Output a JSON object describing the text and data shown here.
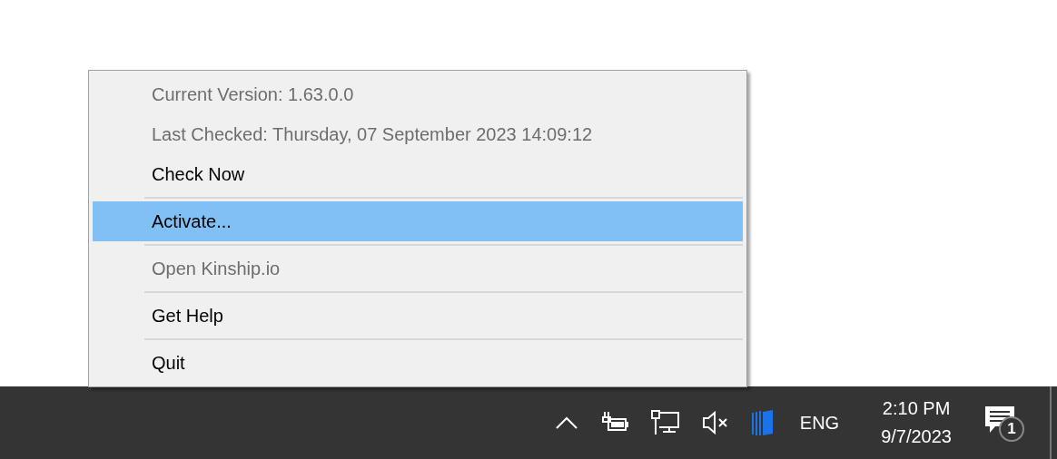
{
  "menu": {
    "items": [
      {
        "kind": "item",
        "label": "Current Version: 1.63.0.0",
        "disabled": true,
        "selected": false
      },
      {
        "kind": "item",
        "label": "Last Checked: Thursday, 07 September 2023 14:09:12",
        "disabled": true,
        "selected": false
      },
      {
        "kind": "item",
        "label": "Check Now",
        "disabled": false,
        "selected": false
      },
      {
        "kind": "separator"
      },
      {
        "kind": "item",
        "label": "Activate...",
        "disabled": false,
        "selected": true
      },
      {
        "kind": "separator"
      },
      {
        "kind": "item",
        "label": "Open Kinship.io",
        "disabled": true,
        "selected": false
      },
      {
        "kind": "separator"
      },
      {
        "kind": "item",
        "label": "Get Help",
        "disabled": false,
        "selected": false
      },
      {
        "kind": "separator"
      },
      {
        "kind": "item",
        "label": "Quit",
        "disabled": false,
        "selected": false
      }
    ]
  },
  "taskbar": {
    "language": "ENG",
    "time": "2:10 PM",
    "date": "9/7/2023",
    "notification_count": "1"
  }
}
